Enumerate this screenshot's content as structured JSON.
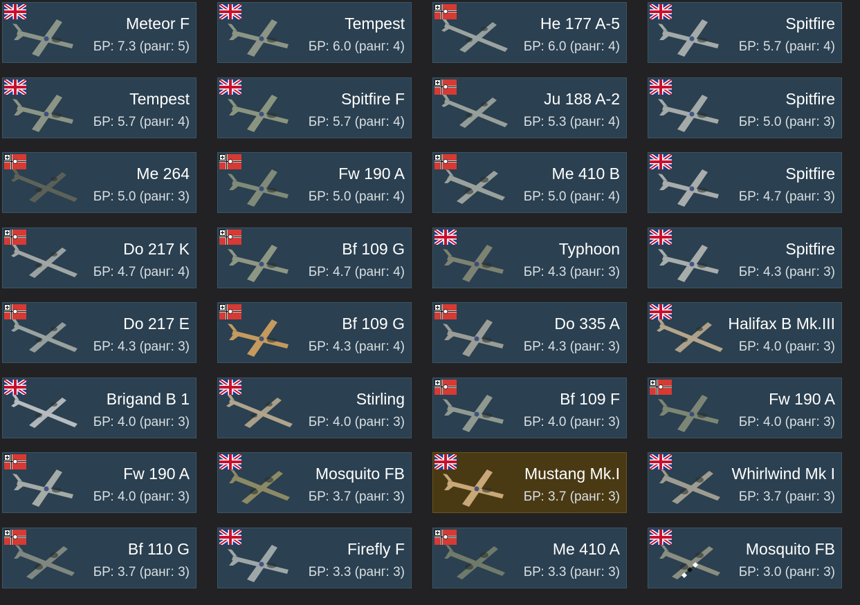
{
  "vehicles": [
    {
      "name": "Meteor F",
      "br": "БР: 7.3 (ранг: 5)",
      "flag": "uk-flag-icon",
      "plane": "jet-fighter-icon",
      "color": "#8a9488"
    },
    {
      "name": "Tempest",
      "br": "БР: 6.0 (ранг: 4)",
      "flag": "uk-flag-icon",
      "plane": "fighter-icon",
      "color": "#8c9585"
    },
    {
      "name": "He 177 A-5",
      "br": "БР: 6.0 (ранг: 4)",
      "flag": "german-flag-icon",
      "plane": "bomber-icon",
      "color": "#9aa3a0"
    },
    {
      "name": "Spitfire",
      "br": "БР: 5.7 (ранг: 4)",
      "flag": "uk-flag-icon",
      "plane": "fighter-icon",
      "color": "#a3aaa8"
    },
    {
      "name": "Tempest",
      "br": "БР: 5.7 (ранг: 4)",
      "flag": "uk-flag-icon",
      "plane": "fighter-icon",
      "color": "#8c9585"
    },
    {
      "name": "Spitfire F",
      "br": "БР: 5.7 (ранг: 4)",
      "flag": "uk-flag-icon",
      "plane": "fighter-icon",
      "color": "#8a957f"
    },
    {
      "name": "Ju 188 A-2",
      "br": "БР: 5.3 (ранг: 4)",
      "flag": "german-flag-icon",
      "plane": "bomber-icon",
      "color": "#98a09a"
    },
    {
      "name": "Spitfire",
      "br": "БР: 5.0 (ранг: 3)",
      "flag": "uk-flag-icon",
      "plane": "fighter-icon",
      "color": "#a3aaa8"
    },
    {
      "name": "Me 264",
      "br": "БР: 5.0 (ранг: 3)",
      "flag": "german-flag-icon",
      "plane": "bomber-icon",
      "color": "#5d6258"
    },
    {
      "name": "Fw 190 A",
      "br": "БР: 5.0 (ранг: 4)",
      "flag": "german-flag-icon",
      "plane": "fighter-icon",
      "color": "#7f8a78"
    },
    {
      "name": "Me 410 B",
      "br": "БР: 5.0 (ранг: 4)",
      "flag": "german-flag-icon",
      "plane": "heavy-fighter-icon",
      "color": "#9aa09c"
    },
    {
      "name": "Spitfire",
      "br": "БР: 4.7 (ранг: 3)",
      "flag": "uk-flag-icon",
      "plane": "fighter-icon",
      "color": "#a8adab"
    },
    {
      "name": "Do 217 K",
      "br": "БР: 4.7 (ранг: 4)",
      "flag": "german-flag-icon",
      "plane": "bomber-icon",
      "color": "#a0a6a4"
    },
    {
      "name": "Bf 109 G",
      "br": "БР: 4.7 (ранг: 4)",
      "flag": "german-flag-icon",
      "plane": "fighter-icon",
      "color": "#8e9684"
    },
    {
      "name": "Typhoon",
      "br": "БР: 4.3 (ранг: 3)",
      "flag": "uk-flag-icon",
      "plane": "fighter-icon",
      "color": "#7d8272"
    },
    {
      "name": "Spitfire",
      "br": "БР: 4.3 (ранг: 3)",
      "flag": "uk-flag-icon",
      "plane": "fighter-icon",
      "color": "#a8adab"
    },
    {
      "name": "Do 217 E",
      "br": "БР: 4.3 (ранг: 3)",
      "flag": "german-flag-icon",
      "plane": "bomber-icon",
      "color": "#9aa2a0"
    },
    {
      "name": "Bf 109 G",
      "br": "БР: 4.3 (ранг: 4)",
      "flag": "german-flag-icon",
      "plane": "fighter-icon",
      "color": "#c49a5e"
    },
    {
      "name": "Do 335 A",
      "br": "БР: 4.3 (ранг: 3)",
      "flag": "german-flag-icon",
      "plane": "fighter-icon",
      "color": "#9a9c96"
    },
    {
      "name": "Halifax B Mk.III",
      "br": "БР: 4.0 (ранг: 3)",
      "flag": "uk-flag-icon",
      "plane": "bomber-icon",
      "color": "#b3a58c"
    },
    {
      "name": "Brigand B 1",
      "br": "БР: 4.0 (ранг: 3)",
      "flag": "uk-flag-icon",
      "plane": "bomber-icon",
      "color": "#b7bcc0"
    },
    {
      "name": "Stirling",
      "br": "БР: 4.0 (ранг: 3)",
      "flag": "uk-flag-icon",
      "plane": "bomber-icon",
      "color": "#b0a48c"
    },
    {
      "name": "Bf 109 F",
      "br": "БР: 4.0 (ранг: 3)",
      "flag": "german-flag-icon",
      "plane": "fighter-icon",
      "color": "#8f9990"
    },
    {
      "name": "Fw 190 A",
      "br": "БР: 4.0 (ранг: 3)",
      "flag": "german-flag-icon",
      "plane": "fighter-icon",
      "color": "#7d8674"
    },
    {
      "name": "Fw 190 A",
      "br": "БР: 4.0 (ранг: 3)",
      "flag": "german-flag-icon",
      "plane": "fighter-icon",
      "color": "#a4aaa6"
    },
    {
      "name": "Mosquito FB",
      "br": "БР: 3.7 (ранг: 3)",
      "flag": "uk-flag-icon",
      "plane": "heavy-fighter-icon",
      "color": "#8c8a64"
    },
    {
      "name": "Mustang Mk.I",
      "br": "БР: 3.7 (ранг: 3)",
      "flag": "uk-flag-icon",
      "plane": "fighter-icon",
      "color": "#c8a878",
      "gold": true
    },
    {
      "name": "Whirlwind Mk I",
      "br": "БР: 3.7 (ранг: 3)",
      "flag": "uk-flag-icon",
      "plane": "heavy-fighter-icon",
      "color": "#9e9c90"
    },
    {
      "name": "Bf 110 G",
      "br": "БР: 3.7 (ранг: 3)",
      "flag": "german-flag-icon",
      "plane": "heavy-fighter-icon",
      "color": "#7f8780"
    },
    {
      "name": "Firefly F",
      "br": "БР: 3.3 (ранг: 3)",
      "flag": "uk-flag-icon",
      "plane": "fighter-icon",
      "color": "#9ea7a8"
    },
    {
      "name": "Me 410 A",
      "br": "БР: 3.3 (ранг: 3)",
      "flag": "german-flag-icon",
      "plane": "heavy-fighter-icon",
      "color": "#6f7a6a"
    },
    {
      "name": "Mosquito FB",
      "br": "БР: 3.0 (ранг: 3)",
      "flag": "uk-flag-icon",
      "plane": "heavy-fighter-icon",
      "color": "#8a8e80",
      "stripes": true
    }
  ],
  "colors": {
    "card_bg": "#2b4050",
    "card_gold_bg": "#4a3a14",
    "uk_blue": "#1f3f8f",
    "uk_red": "#c8102e",
    "de_red": "#d63a34",
    "de_black": "#111111"
  }
}
